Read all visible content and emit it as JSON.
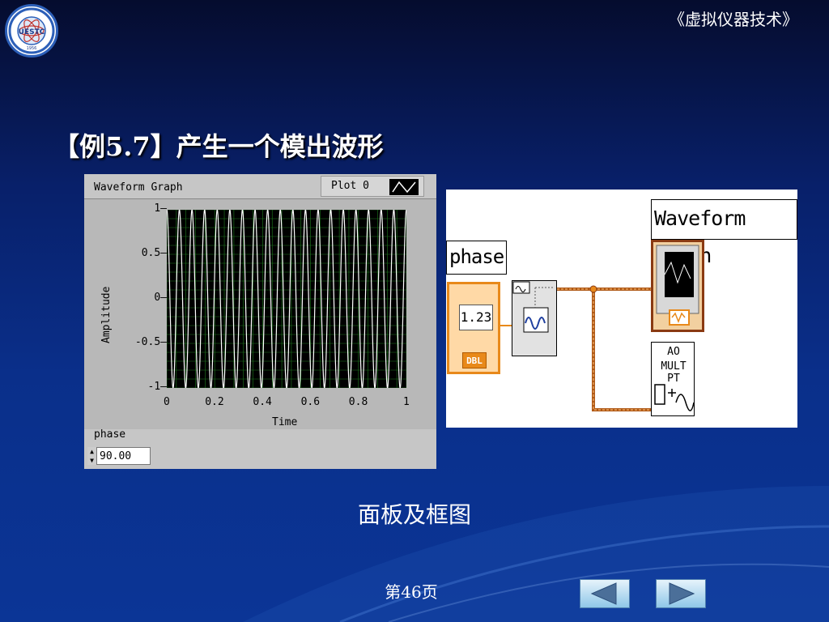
{
  "header": {
    "course_title": "《虚拟仪器技术》",
    "logo_text": "UESTC",
    "logo_year": "1956"
  },
  "slide": {
    "title": "【例5.7】产生一个模出波形",
    "caption": "面板及框图",
    "page_number": "第46页"
  },
  "front_panel": {
    "graph_label": "Waveform Graph",
    "legend_plot": "Plot 0",
    "y_axis_title": "Amplitude",
    "x_axis_title": "Time",
    "y_ticks": [
      "1",
      "0.5",
      "0",
      "-0.5",
      "-1"
    ],
    "x_ticks": [
      "0",
      "0.2",
      "0.4",
      "0.6",
      "0.8",
      "1"
    ],
    "phase_label": "phase",
    "phase_value": "90.00"
  },
  "block_diagram": {
    "phase_label": "phase",
    "phase_control_value": "1.23",
    "phase_type": "DBL",
    "graph_label": "Waveform Graph",
    "ao_line1": "AO",
    "ao_line2": "MULT PT"
  },
  "chart_data": {
    "type": "line",
    "xlabel": "Time",
    "ylabel": "Amplitude",
    "xlim": [
      0,
      1
    ],
    "ylim": [
      -1,
      1
    ],
    "x_ticks": [
      0,
      0.2,
      0.4,
      0.6,
      0.8,
      1
    ],
    "y_ticks": [
      1,
      0.5,
      0,
      -0.5,
      -1
    ],
    "grid": true,
    "legend": "top-right",
    "series": [
      {
        "name": "Plot 0",
        "waveform": "sine",
        "amplitude": 1,
        "cycles": 19,
        "phase_deg": 90
      }
    ],
    "colors": {
      "plot_background": "#000000",
      "grid": "#1f7a1f",
      "trace": "#ffffff"
    }
  },
  "navigation": {
    "prev_icon": "arrow-left-icon",
    "next_icon": "arrow-right-icon"
  }
}
